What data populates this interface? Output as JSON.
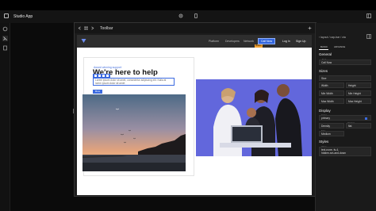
{
  "app": {
    "title": "Studio App"
  },
  "frame": {
    "title": "Toolbar"
  },
  "site": {
    "nav": {
      "links": [
        "Platform",
        "Developers",
        "Network"
      ],
      "cta": "Call Now",
      "cta_tag": "Button",
      "login": "Log In",
      "signup": "Sign Up"
    },
    "hero": {
      "eyebrow": "Award winning support",
      "headline": "We're here to help",
      "body": "Lorem ipsum dolor sit amet, consectetur adipiscing elit. Nulla at lorem ipsum dolor sit amet",
      "button": "More"
    }
  },
  "panel": {
    "breadcrumb": "‹ layout / cap-bar / cta",
    "tabs": [
      "BASIC",
      "ADVANCE"
    ],
    "general": {
      "title": "General",
      "text_label": "Text",
      "text_value": "Call Now"
    },
    "sizes": {
      "title": "Sizes",
      "size_value": "Size",
      "width": "Width",
      "height": "Height",
      "min_width": "Min Width",
      "min_height": "Min Height",
      "max_width": "Max Width",
      "max_height": "Max Height"
    },
    "display": {
      "title": "Display",
      "color_label": "Color",
      "color_value": "primary",
      "density_label": "Density",
      "variant_label": "Variant",
      "variant_value": "flat",
      "size_label": "Size",
      "size_value": "Medium"
    },
    "styles": {
      "title": "Styles",
      "value_label": "Value",
      "value_line1": "text-none, fs-4,",
      "value_line2": "hidden-sm-and-down"
    }
  },
  "colors": {
    "accent": "#3b6ae0",
    "highlight": "#f0a030"
  }
}
